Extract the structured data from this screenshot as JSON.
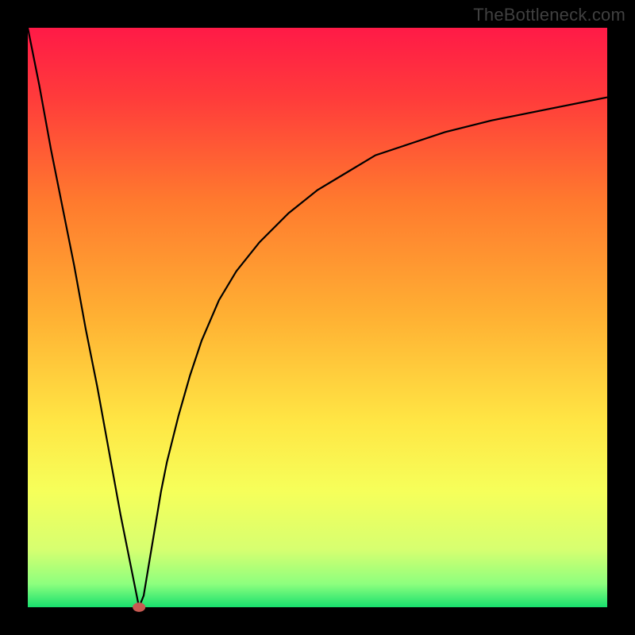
{
  "watermark": "TheBottleneck.com",
  "chart_data": {
    "type": "line",
    "title": "",
    "xlabel": "",
    "ylabel": "",
    "xlim": [
      0,
      100
    ],
    "ylim": [
      0,
      100
    ],
    "gradient_stops": [
      {
        "pct": 0,
        "color": "#ff1a47"
      },
      {
        "pct": 12,
        "color": "#ff3b3b"
      },
      {
        "pct": 30,
        "color": "#ff7a2e"
      },
      {
        "pct": 50,
        "color": "#ffb133"
      },
      {
        "pct": 68,
        "color": "#ffe644"
      },
      {
        "pct": 80,
        "color": "#f6ff5a"
      },
      {
        "pct": 90,
        "color": "#d7ff70"
      },
      {
        "pct": 96,
        "color": "#8dff7e"
      },
      {
        "pct": 100,
        "color": "#18e06e"
      }
    ],
    "series": [
      {
        "name": "left-branch",
        "x": [
          0,
          2,
          4,
          6,
          8,
          10,
          12,
          14,
          16,
          18,
          19.2
        ],
        "values": [
          100,
          90,
          79,
          69,
          59,
          48,
          38,
          27,
          16,
          6,
          0
        ]
      },
      {
        "name": "right-branch",
        "x": [
          19.2,
          20,
          21,
          22,
          23,
          24,
          26,
          28,
          30,
          33,
          36,
          40,
          45,
          50,
          55,
          60,
          66,
          72,
          80,
          90,
          100
        ],
        "values": [
          0,
          2,
          8,
          14,
          20,
          25,
          33,
          40,
          46,
          53,
          58,
          63,
          68,
          72,
          75,
          78,
          80,
          82,
          84,
          86,
          88
        ]
      }
    ],
    "marker": {
      "name": "optimum-marker",
      "x": 19.2,
      "y": 0,
      "rx": 1.1,
      "ry": 0.8,
      "color": "#c85a52"
    },
    "curve_stroke": "#000000",
    "curve_width": 2.2
  }
}
